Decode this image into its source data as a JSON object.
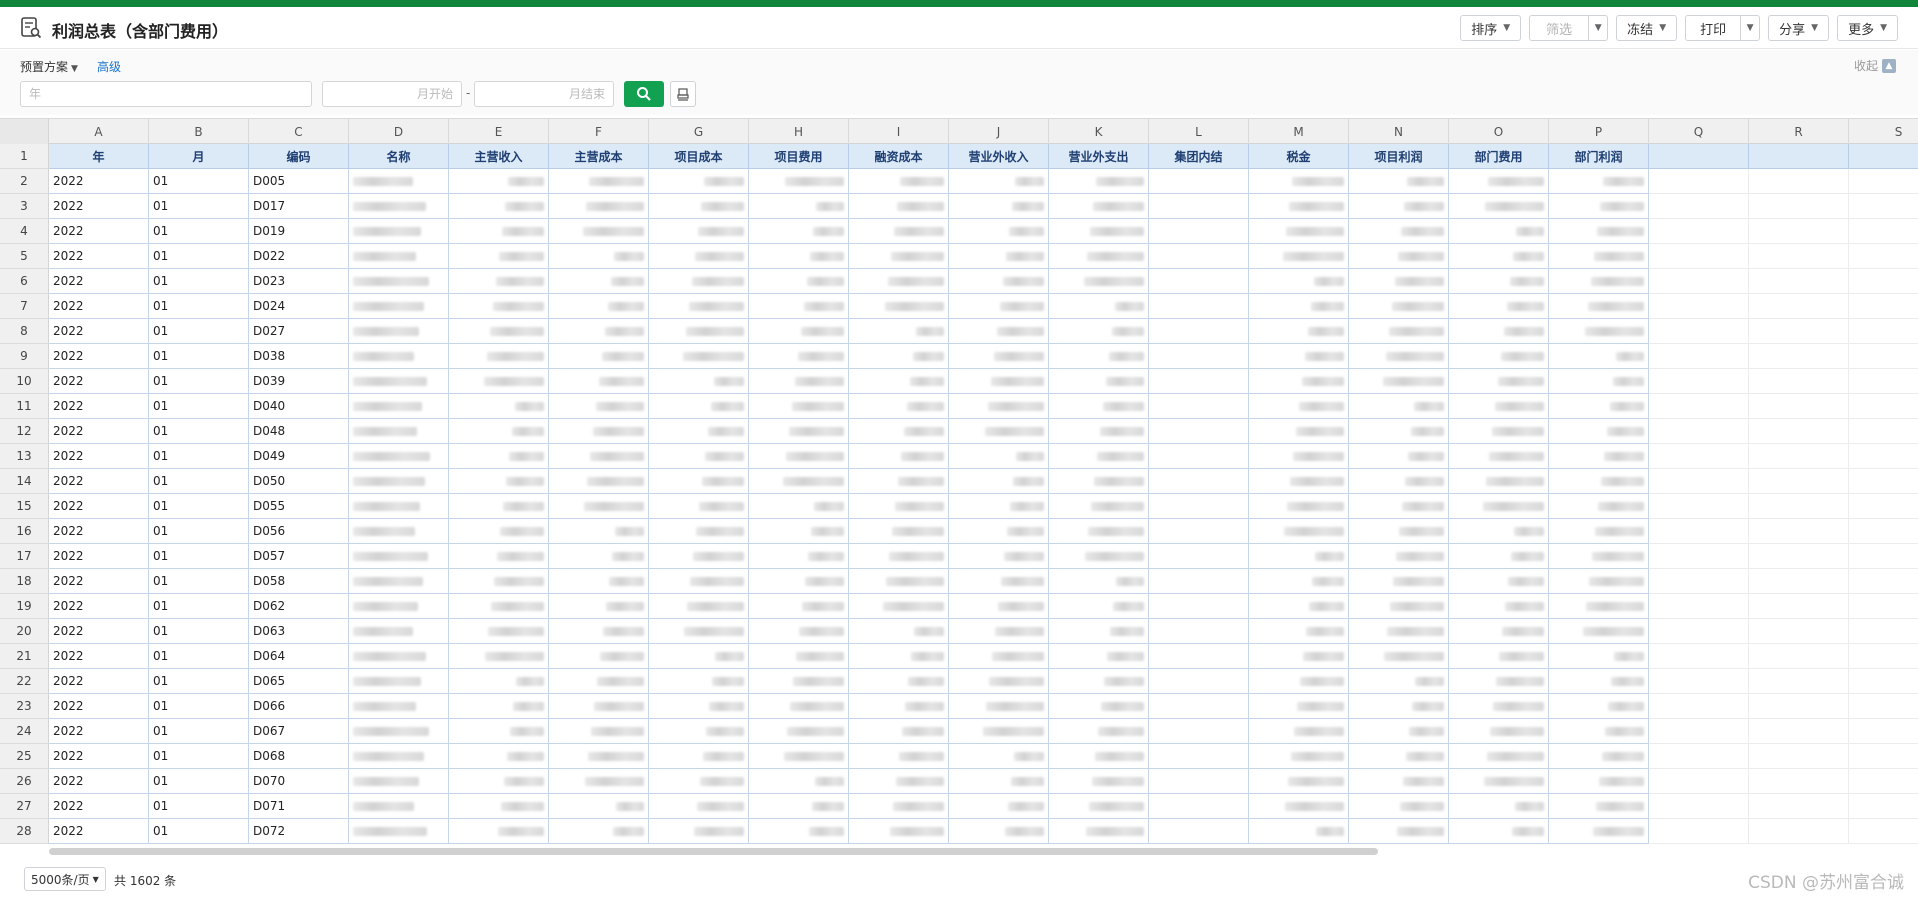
{
  "header": {
    "title": "利润总表（含部门费用）",
    "toolbar": {
      "sort": "排序",
      "filter": "筛选",
      "freeze": "冻结",
      "print": "打印",
      "share": "分享",
      "more": "更多"
    }
  },
  "filters": {
    "preset_label": "预置方案",
    "advanced_label": "高级",
    "collapse_label": "收起",
    "year_placeholder": "年",
    "month_start_placeholder": "月开始",
    "month_end_placeholder": "月结束",
    "range_separator": "-"
  },
  "grid": {
    "column_letters": [
      "A",
      "B",
      "C",
      "D",
      "E",
      "F",
      "G",
      "H",
      "I",
      "J",
      "K",
      "L",
      "M",
      "N",
      "O",
      "P",
      "Q",
      "R",
      "S"
    ],
    "headers": [
      "年",
      "月",
      "编码",
      "名称",
      "主营收入",
      "主营成本",
      "项目成本",
      "项目费用",
      "融资成本",
      "营业外收入",
      "营业外支出",
      "集团内结",
      "税金",
      "项目利润",
      "部门费用",
      "部门利润"
    ],
    "rows": [
      {
        "year": "2022",
        "month": "01",
        "code": "D005"
      },
      {
        "year": "2022",
        "month": "01",
        "code": "D017"
      },
      {
        "year": "2022",
        "month": "01",
        "code": "D019"
      },
      {
        "year": "2022",
        "month": "01",
        "code": "D022"
      },
      {
        "year": "2022",
        "month": "01",
        "code": "D023"
      },
      {
        "year": "2022",
        "month": "01",
        "code": "D024"
      },
      {
        "year": "2022",
        "month": "01",
        "code": "D027"
      },
      {
        "year": "2022",
        "month": "01",
        "code": "D038"
      },
      {
        "year": "2022",
        "month": "01",
        "code": "D039"
      },
      {
        "year": "2022",
        "month": "01",
        "code": "D040"
      },
      {
        "year": "2022",
        "month": "01",
        "code": "D048"
      },
      {
        "year": "2022",
        "month": "01",
        "code": "D049"
      },
      {
        "year": "2022",
        "month": "01",
        "code": "D050"
      },
      {
        "year": "2022",
        "month": "01",
        "code": "D055"
      },
      {
        "year": "2022",
        "month": "01",
        "code": "D056"
      },
      {
        "year": "2022",
        "month": "01",
        "code": "D057"
      },
      {
        "year": "2022",
        "month": "01",
        "code": "D058"
      },
      {
        "year": "2022",
        "month": "01",
        "code": "D062"
      },
      {
        "year": "2022",
        "month": "01",
        "code": "D063"
      },
      {
        "year": "2022",
        "month": "01",
        "code": "D064"
      },
      {
        "year": "2022",
        "month": "01",
        "code": "D065"
      },
      {
        "year": "2022",
        "month": "01",
        "code": "D066"
      },
      {
        "year": "2022",
        "month": "01",
        "code": "D067"
      },
      {
        "year": "2022",
        "month": "01",
        "code": "D068"
      },
      {
        "year": "2022",
        "month": "01",
        "code": "D070"
      },
      {
        "year": "2022",
        "month": "01",
        "code": "D071"
      },
      {
        "year": "2022",
        "month": "01",
        "code": "D072"
      }
    ]
  },
  "footer": {
    "page_size": "5000条/页",
    "total": "共 1602 条",
    "watermark": "CSDN @苏州富合诚"
  },
  "colors": {
    "accent_green": "#12a150",
    "top_strip": "#12853c",
    "header_cell_bg": "#dce9f7",
    "header_cell_text": "#1f3f73",
    "link_blue": "#1a73c9"
  }
}
